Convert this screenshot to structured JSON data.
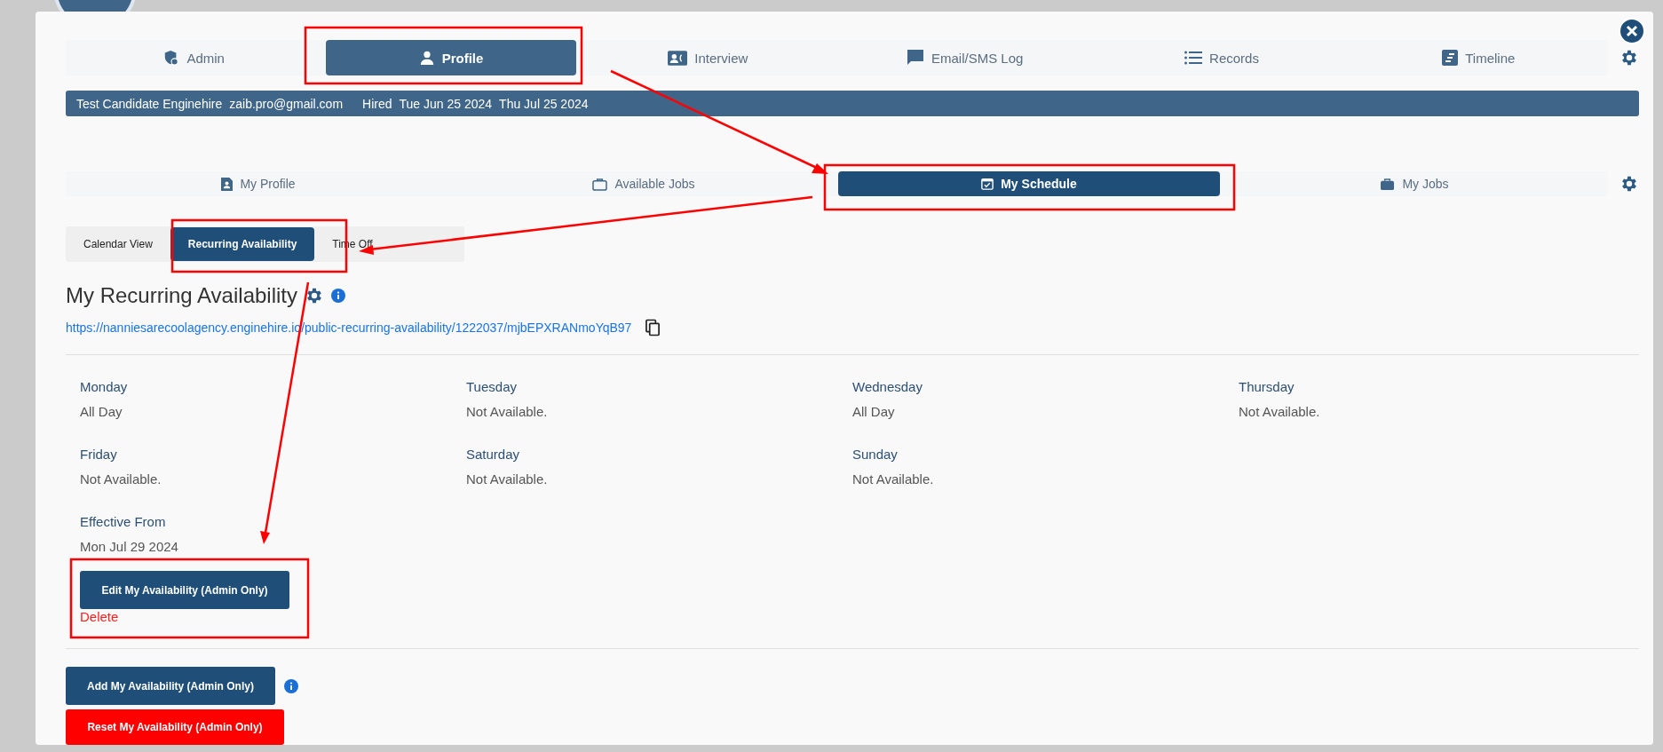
{
  "main_tabs": [
    {
      "label": "Admin",
      "selected": false
    },
    {
      "label": "Profile",
      "selected": true
    },
    {
      "label": "Interview",
      "selected": false
    },
    {
      "label": "Email/SMS Log",
      "selected": false
    },
    {
      "label": "Records",
      "selected": false
    },
    {
      "label": "Timeline",
      "selected": false
    }
  ],
  "candidate_bar": {
    "name": "Test Candidate Enginehire",
    "email": "zaib.pro@gmail.com",
    "status": "Hired",
    "start_date": "Tue Jun 25 2024",
    "end_date": "Thu Jul 25 2024"
  },
  "profile_tabs": [
    {
      "label": "My Profile",
      "selected": false
    },
    {
      "label": "Available Jobs",
      "selected": false
    },
    {
      "label": "My Schedule",
      "selected": true
    },
    {
      "label": "My Jobs",
      "selected": false
    }
  ],
  "schedule_tabs": [
    {
      "label": "Calendar View",
      "selected": false
    },
    {
      "label": "Recurring Availability",
      "selected": true
    },
    {
      "label": "Time Off",
      "selected": false
    }
  ],
  "title": "My Recurring Availability",
  "public_link": "https://nanniesarecoolagency.enginehire.io/public-recurring-availability/1222037/mjbEPXRANmoYqB97",
  "days": [
    {
      "day": "Monday",
      "value": "All Day"
    },
    {
      "day": "Tuesday",
      "value": "Not Available."
    },
    {
      "day": "Wednesday",
      "value": "All Day"
    },
    {
      "day": "Thursday",
      "value": "Not Available."
    },
    {
      "day": "Friday",
      "value": "Not Available."
    },
    {
      "day": "Saturday",
      "value": "Not Available."
    },
    {
      "day": "Sunday",
      "value": "Not Available."
    }
  ],
  "effective_from": {
    "label": "Effective From",
    "value": "Mon Jul 29 2024"
  },
  "edit_button": "Edit My Availability (Admin Only)",
  "delete_link": "Delete",
  "add_button": "Add My Availability (Admin Only)",
  "reset_button": "Reset My Availability (Admin Only)"
}
